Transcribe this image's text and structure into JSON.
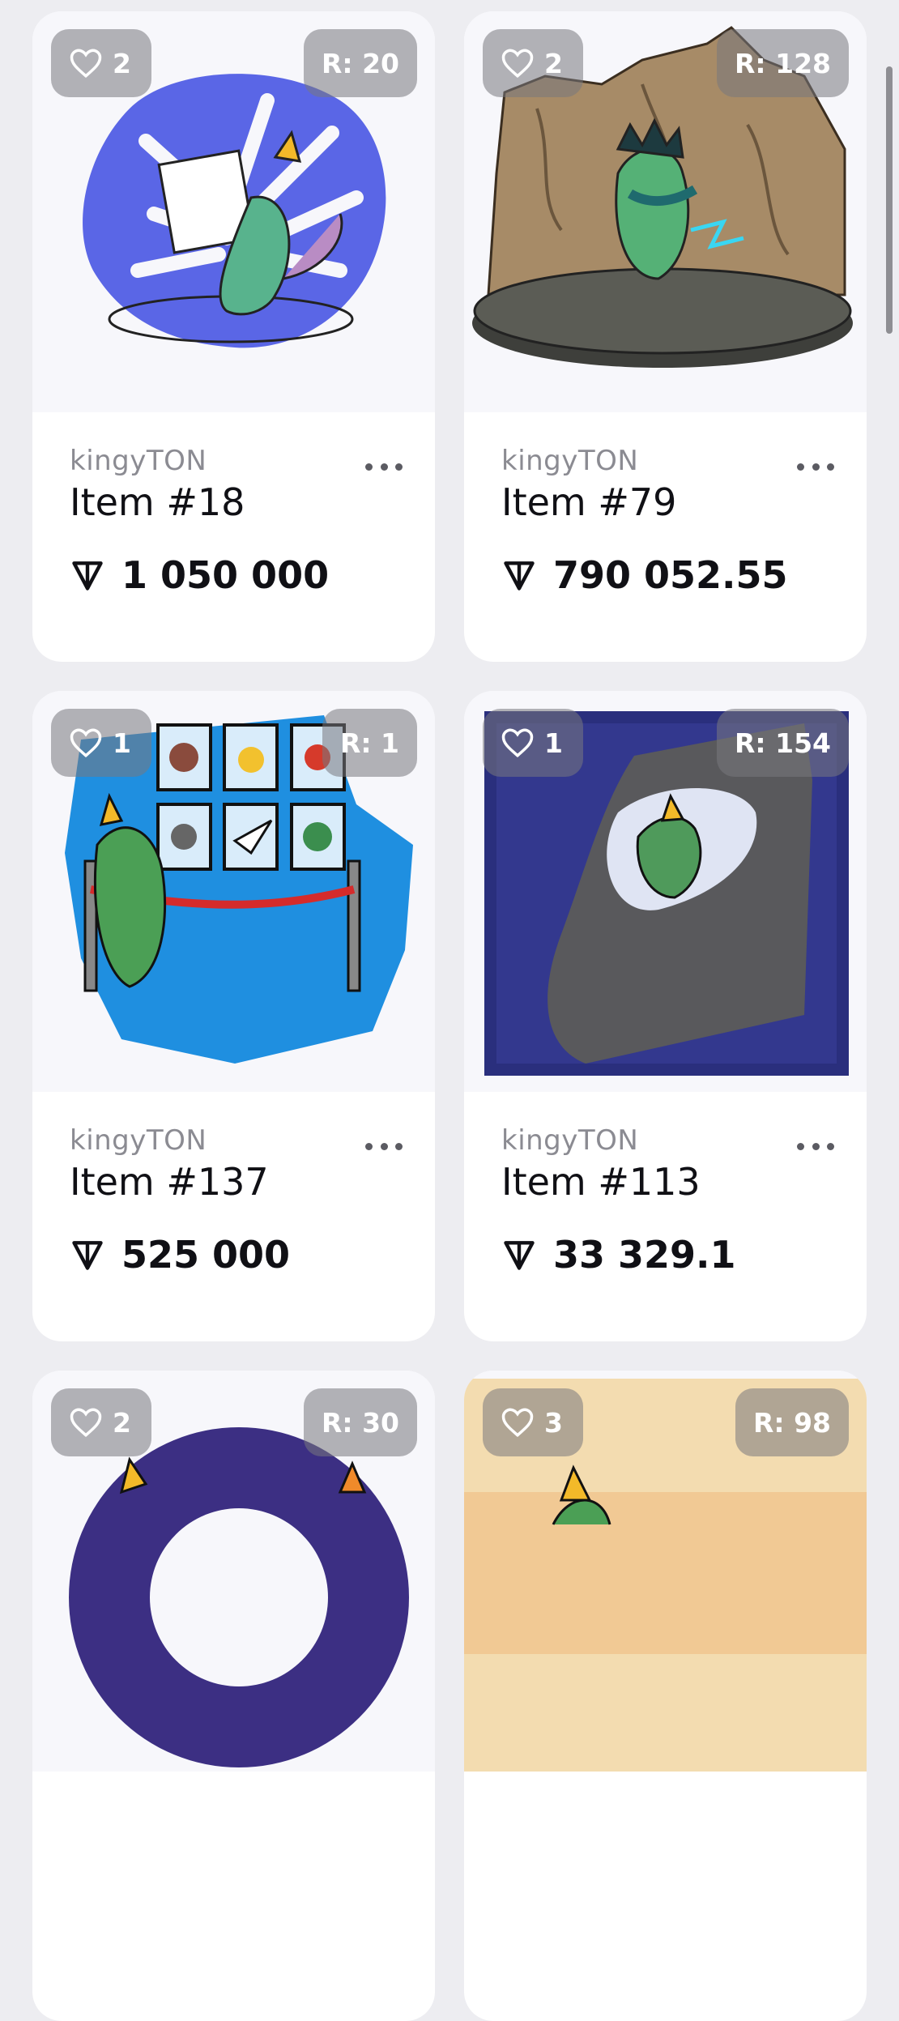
{
  "cards": [
    {
      "likes": "2",
      "rarity": "R: 20",
      "collection": "kingyTON",
      "title": "Item #18",
      "price": "1 050 000"
    },
    {
      "likes": "2",
      "rarity": "R: 128",
      "collection": "kingyTON",
      "title": "Item #79",
      "price": "790 052.55"
    },
    {
      "likes": "1",
      "rarity": "R: 1",
      "collection": "kingyTON",
      "title": "Item #137",
      "price": "525 000"
    },
    {
      "likes": "1",
      "rarity": "R: 154",
      "collection": "kingyTON",
      "title": "Item #113",
      "price": "33 329.1"
    },
    {
      "likes": "2",
      "rarity": "R: 30",
      "collection": "",
      "title": "",
      "price": ""
    },
    {
      "likes": "3",
      "rarity": "R: 98",
      "collection": "",
      "title": "",
      "price": ""
    }
  ],
  "icons": {
    "likes": "heart-icon",
    "menu": "more-horizontal-icon",
    "currency": "ton-icon"
  },
  "colors": {
    "card_bg": "#ffffff",
    "page_bg": "#ededf1",
    "badge_bg": "rgba(120,120,125,0.55)",
    "text_primary": "#101015",
    "text_secondary": "#8b8b92"
  }
}
